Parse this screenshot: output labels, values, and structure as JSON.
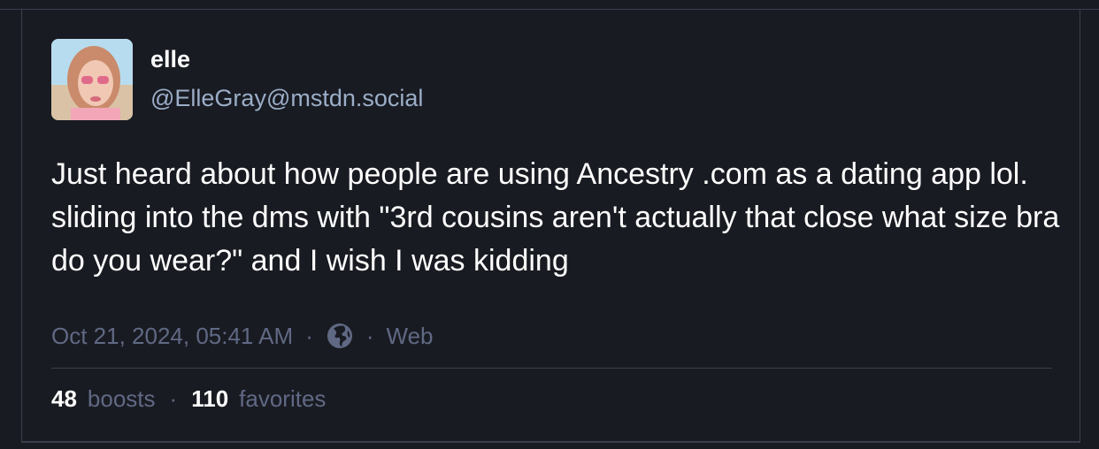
{
  "post": {
    "author": {
      "display_name": "elle",
      "handle": "@ElleGray@mstdn.social"
    },
    "content": "Just heard about how people are using Ancestry .com as a dating app lol. sliding into the dms with \"3rd cousins aren't actually that close what size bra do you wear?\" and I wish I was kidding",
    "timestamp": "Oct 21, 2024, 05:41 AM",
    "separator": "·",
    "visibility_icon": "globe-icon",
    "application": "Web",
    "boosts_count": "48",
    "boosts_label": "boosts",
    "favorites_count": "110",
    "favorites_label": "favorites"
  },
  "colors": {
    "background": "#191b22",
    "border": "#393f4f",
    "text": "#ffffff",
    "muted": "#606984",
    "handle": "#9baec8"
  }
}
